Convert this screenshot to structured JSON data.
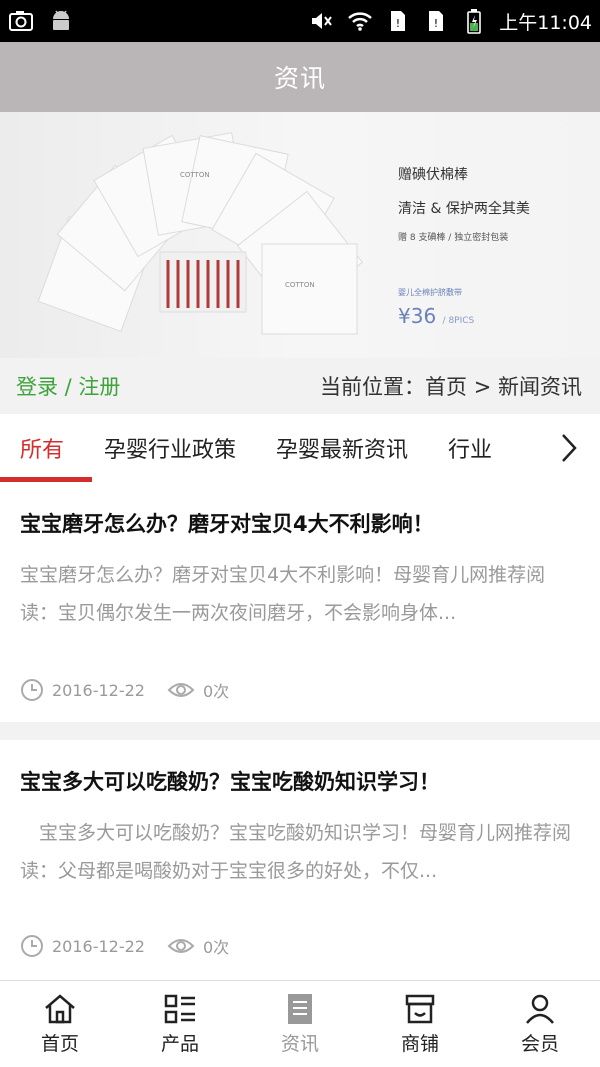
{
  "status_bar": {
    "time": "上午11:04",
    "icons": [
      "screenshot-icon",
      "android-icon",
      "mute-icon",
      "wifi-icon",
      "sim1-icon",
      "sim2-icon",
      "battery-icon"
    ]
  },
  "header": {
    "title": "资讯"
  },
  "banner": {
    "line1": "赠碘伏棉棒",
    "line2": "清洁 & 保护两全其美",
    "line3": "赠 8 支碘棒 / 独立密封包装",
    "line4": "婴儿全棉护脐敷带",
    "price": "¥36",
    "price_unit": "/ 8PICS"
  },
  "location_bar": {
    "login": "登录 / 注册",
    "location": "当前位置：首页 > 新闻资讯"
  },
  "tabs": {
    "items": [
      {
        "label": "所有"
      },
      {
        "label": "孕婴行业政策"
      },
      {
        "label": "孕婴最新资讯"
      },
      {
        "label": "行业"
      }
    ]
  },
  "articles": [
    {
      "title": "宝宝磨牙怎么办？磨牙对宝贝4大不利影响！",
      "summary": "宝宝磨牙怎么办？磨牙对宝贝4大不利影响！母婴育儿网推荐阅读：宝贝偶尔发生一两次夜间磨牙，不会影响身体...",
      "date": "2016-12-22",
      "views": "0次"
    },
    {
      "title": "宝宝多大可以吃酸奶？宝宝吃酸奶知识学习！",
      "summary": "　宝宝多大可以吃酸奶？宝宝吃酸奶知识学习！母婴育儿网推荐阅读：父母都是喝酸奶对于宝宝很多的好处，不仅...",
      "date": "2016-12-22",
      "views": "0次"
    }
  ],
  "bottom_nav": {
    "items": [
      {
        "label": "首页",
        "icon": "home-icon"
      },
      {
        "label": "产品",
        "icon": "grid-list-icon"
      },
      {
        "label": "资讯",
        "icon": "document-icon"
      },
      {
        "label": "商铺",
        "icon": "shop-icon"
      },
      {
        "label": "会员",
        "icon": "user-icon"
      }
    ],
    "active_label": "资讯"
  }
}
